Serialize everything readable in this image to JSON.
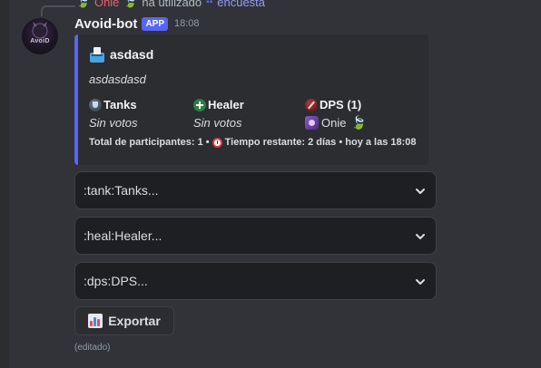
{
  "reply": {
    "user_name": "Onie",
    "action_text": "ha utilizado",
    "command_name": "encuesta"
  },
  "message": {
    "author": "Avoid-bot",
    "badge": "APP",
    "timestamp": "18:08",
    "avatar_text": "AvoiD",
    "edited_label": "(editado)"
  },
  "embed": {
    "accent_color": "#5865f2",
    "title": "asdasd",
    "description": "asdasdasd",
    "fields": [
      {
        "name": "Tanks",
        "icon": "shield-icon",
        "value": "Sin votos"
      },
      {
        "name": "Healer",
        "icon": "heal-icon",
        "value": "Sin votos"
      },
      {
        "name": "DPS (1)",
        "icon": "dps-icon",
        "value": "Onie"
      }
    ],
    "footer": {
      "participants": "Total de participantes: 1 •",
      "time_left": "Tiempo restante: 2 días • hoy a las 18:08"
    }
  },
  "selects": [
    {
      "placeholder": ":tank:Tanks..."
    },
    {
      "placeholder": ":heal:Healer..."
    },
    {
      "placeholder": ":dps:DPS..."
    }
  ],
  "export_button": {
    "label": "Exportar"
  }
}
